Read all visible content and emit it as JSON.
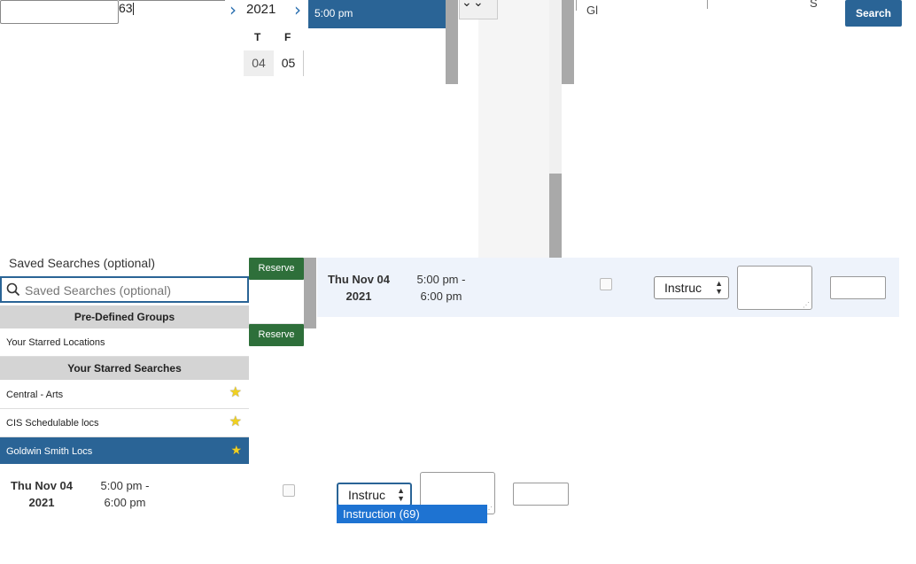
{
  "top": {
    "input_value": "",
    "number_value": "63",
    "year": "2021",
    "time_slot": "5:00 pm",
    "header_fragment_1": "Gl",
    "header_fragment_2": "S",
    "search_button": "Search"
  },
  "calendar": {
    "days": [
      "T",
      "F"
    ],
    "dates": [
      "04",
      "05"
    ]
  },
  "saved_searches": {
    "label": "Saved Searches (optional)",
    "placeholder": "Saved Searches (optional)",
    "predefined_header": "Pre-Defined Groups",
    "predefined_items": [
      "Your Starred Locations"
    ],
    "starred_header": "Your Starred Searches",
    "starred_items": [
      "Central - Arts",
      "CIS Schedulable locs",
      "Goldwin Smith Locs"
    ],
    "selected_item": "Goldwin Smith Locs"
  },
  "reserve_buttons": [
    "Reserve",
    "Reserve"
  ],
  "row1": {
    "date_line1": "Thu Nov 04",
    "date_line2": "2021",
    "time_line1": "5:00 pm -",
    "time_line2": "6:00 pm",
    "type_select": "Instruc"
  },
  "row2": {
    "date_line1": "Thu Nov 04",
    "date_line2": "2021",
    "time_line1": "5:00 pm -",
    "time_line2": "6:00 pm",
    "type_select": "Instruc",
    "dropdown_option": "Instruction (69)"
  },
  "colors": {
    "accent_blue": "#2a6496",
    "reserve_green": "#2e6f3a",
    "row_highlight": "#eef3fb",
    "star": "#f0d020"
  }
}
